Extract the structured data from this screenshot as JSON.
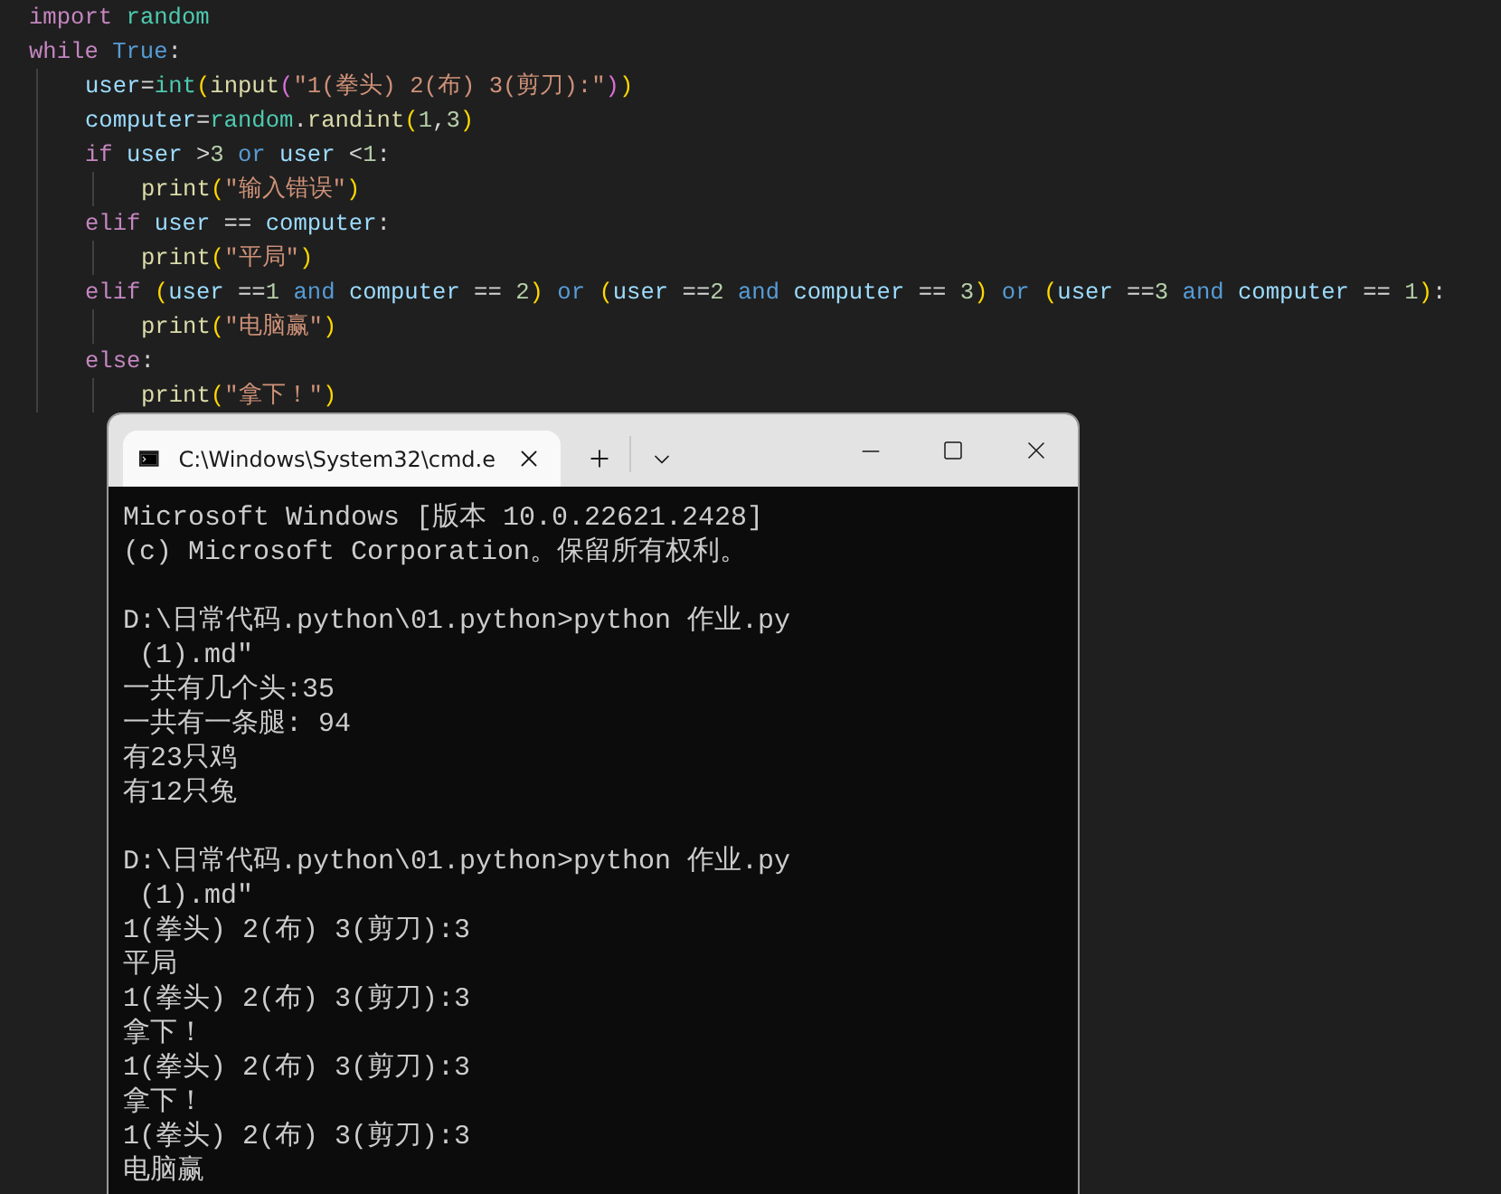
{
  "editor": {
    "lines": [
      {
        "tokens": [
          {
            "kind": "keyword",
            "text": "import "
          },
          {
            "kind": "module",
            "text": "random"
          }
        ]
      },
      {
        "tokens": [
          {
            "kind": "keyword",
            "text": "while "
          },
          {
            "kind": "constant",
            "text": "True"
          },
          {
            "kind": "plain",
            "text": ":"
          }
        ],
        "children": [
          {
            "tokens": [
              {
                "kind": "variable",
                "text": "user"
              },
              {
                "kind": "plain",
                "text": "="
              },
              {
                "kind": "class",
                "text": "int"
              },
              {
                "kind": "bracket1",
                "text": "("
              },
              {
                "kind": "function",
                "text": "input"
              },
              {
                "kind": "bracket2",
                "text": "("
              },
              {
                "kind": "string",
                "text": "\"1(拳头) 2(布) 3(剪刀):\""
              },
              {
                "kind": "bracket2",
                "text": ")"
              },
              {
                "kind": "bracket1",
                "text": ")"
              }
            ]
          },
          {
            "tokens": [
              {
                "kind": "variable",
                "text": "computer"
              },
              {
                "kind": "plain",
                "text": "="
              },
              {
                "kind": "module",
                "text": "random"
              },
              {
                "kind": "plain",
                "text": "."
              },
              {
                "kind": "function",
                "text": "randint"
              },
              {
                "kind": "bracket1",
                "text": "("
              },
              {
                "kind": "number",
                "text": "1"
              },
              {
                "kind": "plain",
                "text": ","
              },
              {
                "kind": "number",
                "text": "3"
              },
              {
                "kind": "bracket1",
                "text": ")"
              }
            ]
          },
          {
            "tokens": [
              {
                "kind": "keyword",
                "text": "if "
              },
              {
                "kind": "variable",
                "text": "user"
              },
              {
                "kind": "plain",
                "text": " >"
              },
              {
                "kind": "number",
                "text": "3 "
              },
              {
                "kind": "logic",
                "text": "or "
              },
              {
                "kind": "variable",
                "text": "user"
              },
              {
                "kind": "plain",
                "text": " <"
              },
              {
                "kind": "number",
                "text": "1"
              },
              {
                "kind": "plain",
                "text": ":"
              }
            ],
            "children": [
              {
                "tokens": [
                  {
                    "kind": "function",
                    "text": "print"
                  },
                  {
                    "kind": "bracket1",
                    "text": "("
                  },
                  {
                    "kind": "string",
                    "text": "\"输入错误\""
                  },
                  {
                    "kind": "bracket1",
                    "text": ")"
                  }
                ]
              }
            ]
          },
          {
            "tokens": [
              {
                "kind": "keyword",
                "text": "elif "
              },
              {
                "kind": "variable",
                "text": "user"
              },
              {
                "kind": "plain",
                "text": " == "
              },
              {
                "kind": "variable",
                "text": "computer"
              },
              {
                "kind": "plain",
                "text": ":"
              }
            ],
            "children": [
              {
                "tokens": [
                  {
                    "kind": "function",
                    "text": "print"
                  },
                  {
                    "kind": "bracket1",
                    "text": "("
                  },
                  {
                    "kind": "string",
                    "text": "\"平局\""
                  },
                  {
                    "kind": "bracket1",
                    "text": ")"
                  }
                ]
              }
            ]
          },
          {
            "tokens": [
              {
                "kind": "keyword",
                "text": "elif "
              },
              {
                "kind": "bracket1",
                "text": "("
              },
              {
                "kind": "variable",
                "text": "user"
              },
              {
                "kind": "plain",
                "text": " =="
              },
              {
                "kind": "number",
                "text": "1 "
              },
              {
                "kind": "logic",
                "text": "and "
              },
              {
                "kind": "variable",
                "text": "computer"
              },
              {
                "kind": "plain",
                "text": " == "
              },
              {
                "kind": "number",
                "text": "2"
              },
              {
                "kind": "bracket1",
                "text": ") "
              },
              {
                "kind": "logic",
                "text": "or "
              },
              {
                "kind": "bracket1",
                "text": "("
              },
              {
                "kind": "variable",
                "text": "user"
              },
              {
                "kind": "plain",
                "text": " =="
              },
              {
                "kind": "number",
                "text": "2 "
              },
              {
                "kind": "logic",
                "text": "and "
              },
              {
                "kind": "variable",
                "text": "computer"
              },
              {
                "kind": "plain",
                "text": " == "
              },
              {
                "kind": "number",
                "text": "3"
              },
              {
                "kind": "bracket1",
                "text": ") "
              },
              {
                "kind": "logic",
                "text": "or "
              },
              {
                "kind": "bracket1",
                "text": "("
              },
              {
                "kind": "variable",
                "text": "user"
              },
              {
                "kind": "plain",
                "text": " =="
              },
              {
                "kind": "number",
                "text": "3 "
              },
              {
                "kind": "logic",
                "text": "and "
              },
              {
                "kind": "variable",
                "text": "computer"
              },
              {
                "kind": "plain",
                "text": " == "
              },
              {
                "kind": "number",
                "text": "1"
              },
              {
                "kind": "bracket1",
                "text": ")"
              },
              {
                "kind": "plain",
                "text": ":"
              }
            ],
            "children": [
              {
                "tokens": [
                  {
                    "kind": "function",
                    "text": "print"
                  },
                  {
                    "kind": "bracket1",
                    "text": "("
                  },
                  {
                    "kind": "string",
                    "text": "\"电脑赢\""
                  },
                  {
                    "kind": "bracket1",
                    "text": ")"
                  }
                ]
              }
            ]
          },
          {
            "tokens": [
              {
                "kind": "keyword",
                "text": "else"
              },
              {
                "kind": "plain",
                "text": ":"
              }
            ],
            "children": [
              {
                "tokens": [
                  {
                    "kind": "function",
                    "text": "print"
                  },
                  {
                    "kind": "bracket1",
                    "text": "("
                  },
                  {
                    "kind": "string",
                    "text": "\"拿下！\""
                  },
                  {
                    "kind": "bracket1",
                    "text": ")"
                  }
                ]
              }
            ]
          }
        ]
      }
    ]
  },
  "terminal": {
    "tab_title": "C:\\Windows\\System32\\cmd.e",
    "output_blocks": [
      [
        "Microsoft Windows [版本 10.0.22621.2428]",
        "(c) Microsoft Corporation。保留所有权利。"
      ],
      [
        "D:\\日常代码.python\\01.python>python 作业.py",
        " (1).md\"",
        "一共有几个头:35",
        "一共有一条腿: 94",
        "有23只鸡",
        "有12只兔"
      ],
      [
        "D:\\日常代码.python\\01.python>python 作业.py",
        " (1).md\"",
        "1(拳头) 2(布) 3(剪刀):3",
        "平局",
        "1(拳头) 2(布) 3(剪刀):3",
        "拿下！",
        "1(拳头) 2(布) 3(剪刀):3",
        "拿下！",
        "1(拳头) 2(布) 3(剪刀):3",
        "电脑赢"
      ]
    ]
  }
}
